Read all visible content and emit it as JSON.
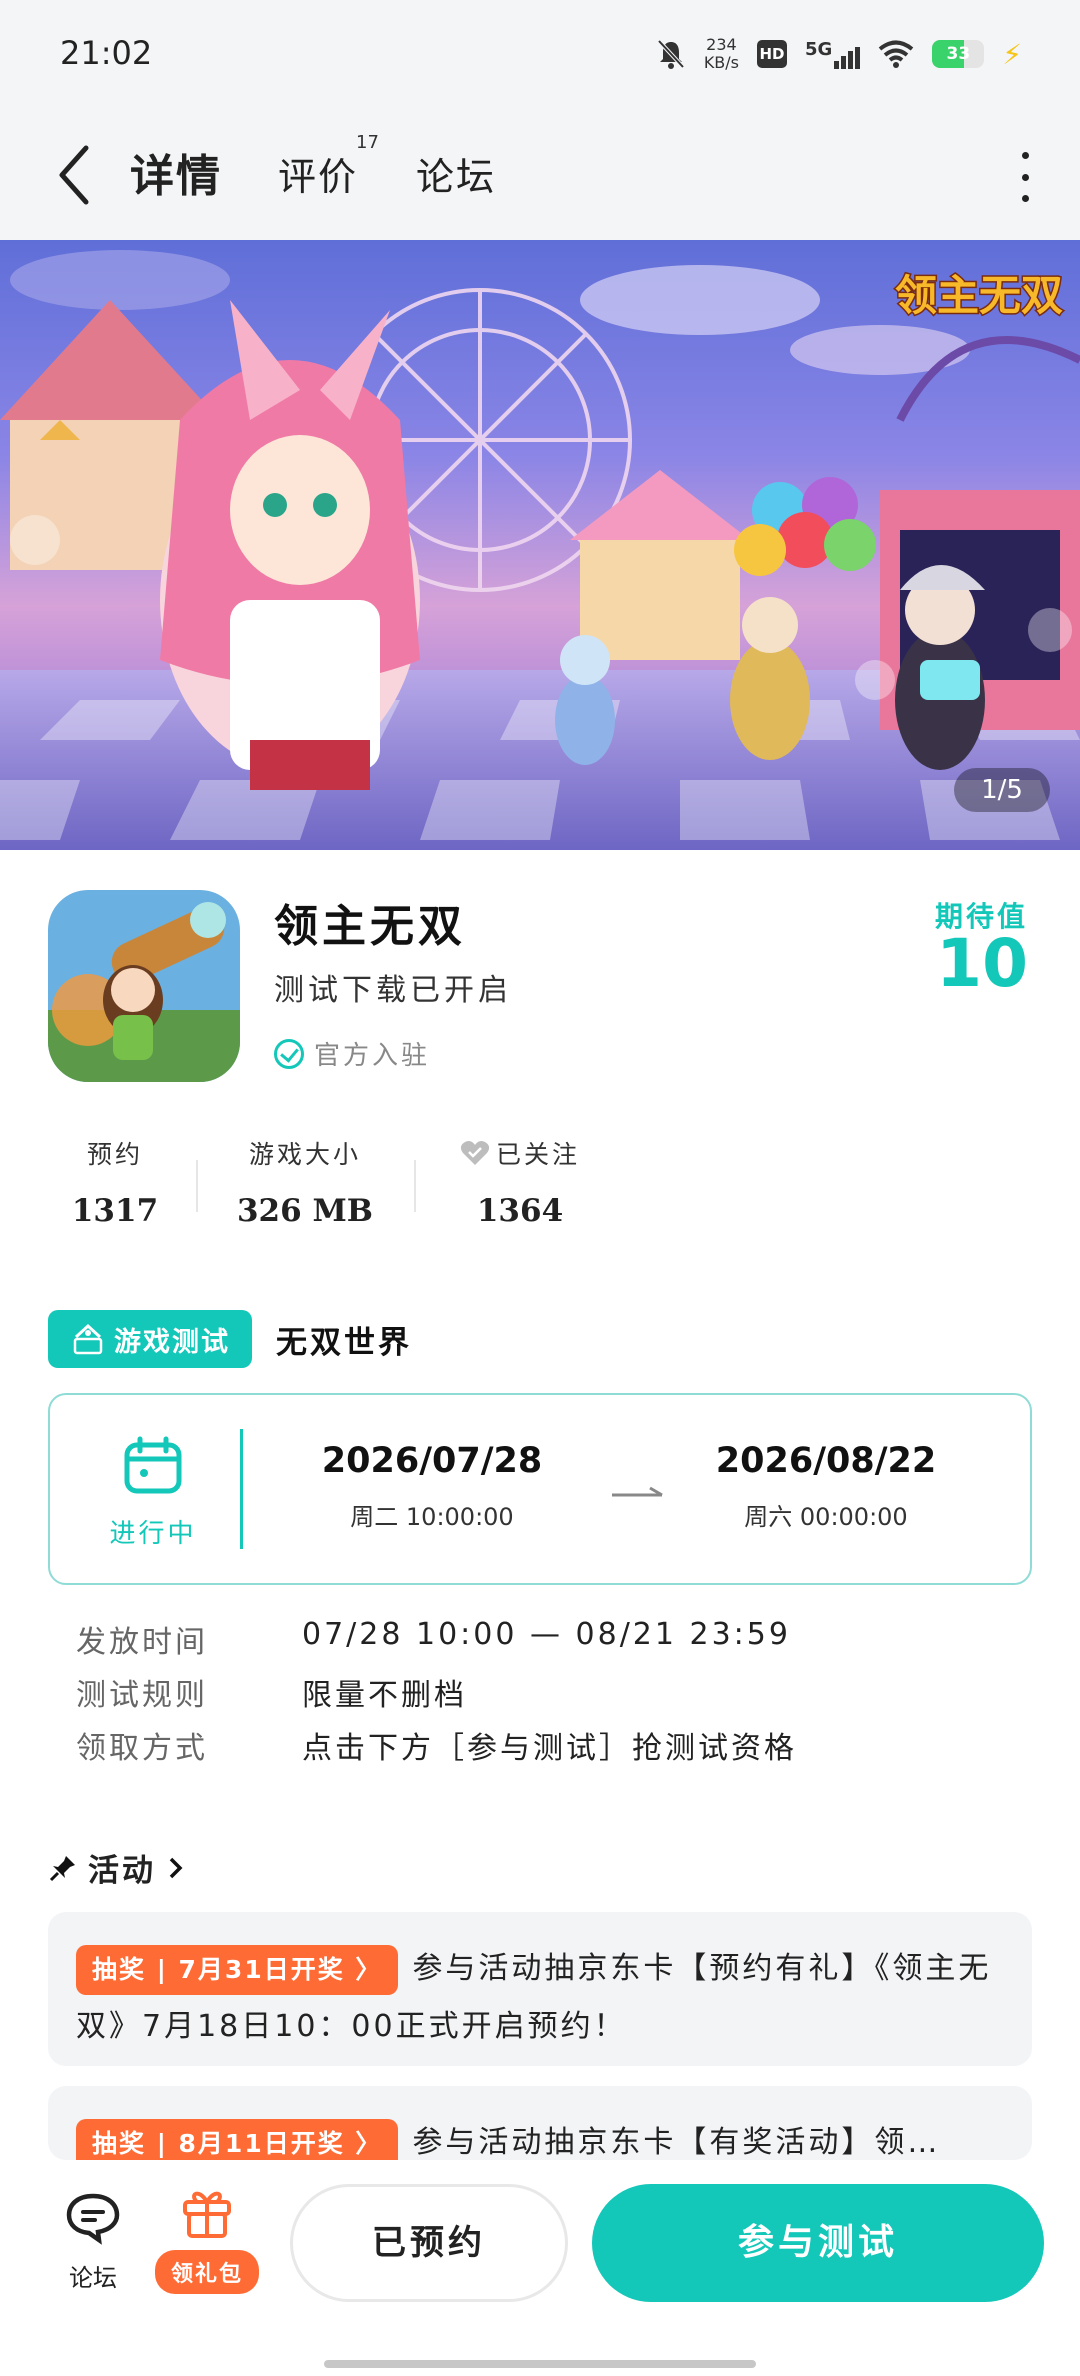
{
  "status_bar": {
    "time": "21:02",
    "net_speed": "234",
    "net_unit": "KB/s",
    "hd": "HD",
    "network": "5G",
    "battery": "33"
  },
  "nav": {
    "tabs": [
      "详情",
      "评价",
      "论坛"
    ],
    "review_count": "17"
  },
  "banner": {
    "counter": "1/5",
    "logo_text": "领主无双"
  },
  "app": {
    "name": "领主无双",
    "subtitle": "测试下载已开启",
    "official": "官方入驻",
    "expect_label": "期待值",
    "expect_value": "10"
  },
  "stats": [
    {
      "label": "预约",
      "value": "1317"
    },
    {
      "label": "游戏大小",
      "value": "326 MB"
    },
    {
      "label": "已关注",
      "value": "1364"
    }
  ],
  "test": {
    "badge": "游戏测试",
    "title": "无双世界",
    "status": "进行中",
    "start_date": "2026/07/28",
    "start_time": "周二  10:00:00",
    "end_date": "2026/08/22",
    "end_time": "周六  00:00:00",
    "rows": [
      {
        "label": "发放时间",
        "value": "07/28 10:00 — 08/21 23:59"
      },
      {
        "label": "测试规则",
        "value": "限量不删档"
      },
      {
        "label": "领取方式",
        "value": "点击下方［参与测试］抢测试资格"
      }
    ]
  },
  "activity": {
    "title": "活动",
    "items": [
      {
        "tag": "抽奖 | 7月31日开奖 〉",
        "text": "参与活动抽京东卡【预约有礼】《领主无双》7月18日10：00正式开启预约！"
      },
      {
        "tag": "抽奖 | 8月11日开奖 〉",
        "text": "参与活动抽京东卡【有奖活动】领…"
      }
    ]
  },
  "bottom": {
    "forum": "论坛",
    "gift": "领礼包",
    "reserved": "已预约",
    "join": "参与测试"
  }
}
